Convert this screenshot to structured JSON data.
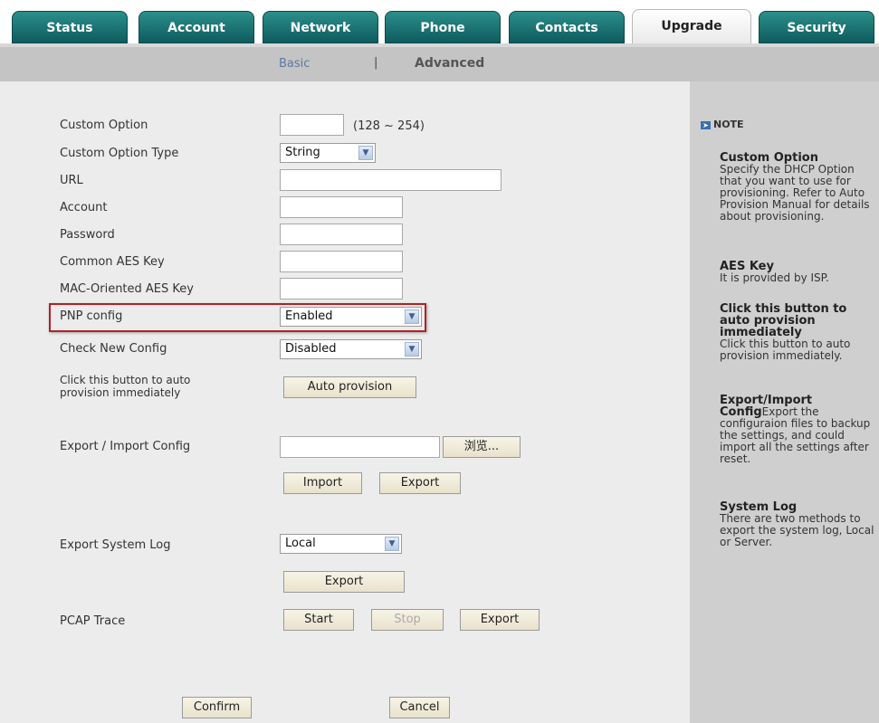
{
  "tabs": [
    "Status",
    "Account",
    "Network",
    "Phone",
    "Contacts",
    "Upgrade",
    "Security"
  ],
  "active_tab": "Upgrade",
  "subnav": {
    "basic": "Basic",
    "separator": "|",
    "advanced": "Advanced"
  },
  "form": {
    "custom_option": {
      "label": "Custom Option",
      "value": "",
      "range": "(128 ~ 254)"
    },
    "custom_option_type": {
      "label": "Custom Option Type",
      "value": "String"
    },
    "url": {
      "label": "URL",
      "value": ""
    },
    "account": {
      "label": "Account",
      "value": ""
    },
    "password": {
      "label": "Password",
      "value": ""
    },
    "common_aes": {
      "label": "Common AES Key",
      "value": ""
    },
    "mac_aes": {
      "label": "MAC-Oriented AES Key",
      "value": ""
    },
    "pnp_config": {
      "label": "PNP config",
      "value": "Enabled"
    },
    "check_new_config": {
      "label": "Check New Config",
      "value": "Disabled"
    },
    "auto_provision": {
      "label_line1": "Click this button to auto",
      "label_line2": "provision immediately",
      "button": "Auto provision"
    },
    "export_import": {
      "label": "Export / Import Config",
      "file_value": "",
      "browse": "浏览...",
      "import": "Import",
      "export": "Export"
    },
    "system_log": {
      "label": "Export System Log",
      "value": "Local",
      "export": "Export"
    },
    "pcap": {
      "label": "PCAP Trace",
      "start": "Start",
      "stop": "Stop",
      "export": "Export"
    },
    "confirm": "Confirm",
    "cancel": "Cancel"
  },
  "note": {
    "header": "NOTE",
    "items": [
      {
        "title": "Custom Option",
        "text": "Specify the DHCP Option that you want to use for provisioning. Refer to Auto Provision Manual for details about provisioning."
      },
      {
        "title": "AES Key",
        "text": "It is provided by ISP."
      },
      {
        "title": "Click this button to auto provision immediately",
        "text": "Click this button to auto provision immediately."
      },
      {
        "title": "Export/Import",
        "title2": "Config",
        "text": "Export the configuraion files to backup the settings, and could import all the settings after reset."
      },
      {
        "title": "System Log",
        "text": "There are two methods to export the system log, Local or Server."
      }
    ]
  },
  "colors": {
    "tab": "#0e5b5e",
    "highlight": "#b52025",
    "subnav": "#c4c4c4",
    "main_bg": "#ececec",
    "side_bg": "#cfcfcf"
  }
}
